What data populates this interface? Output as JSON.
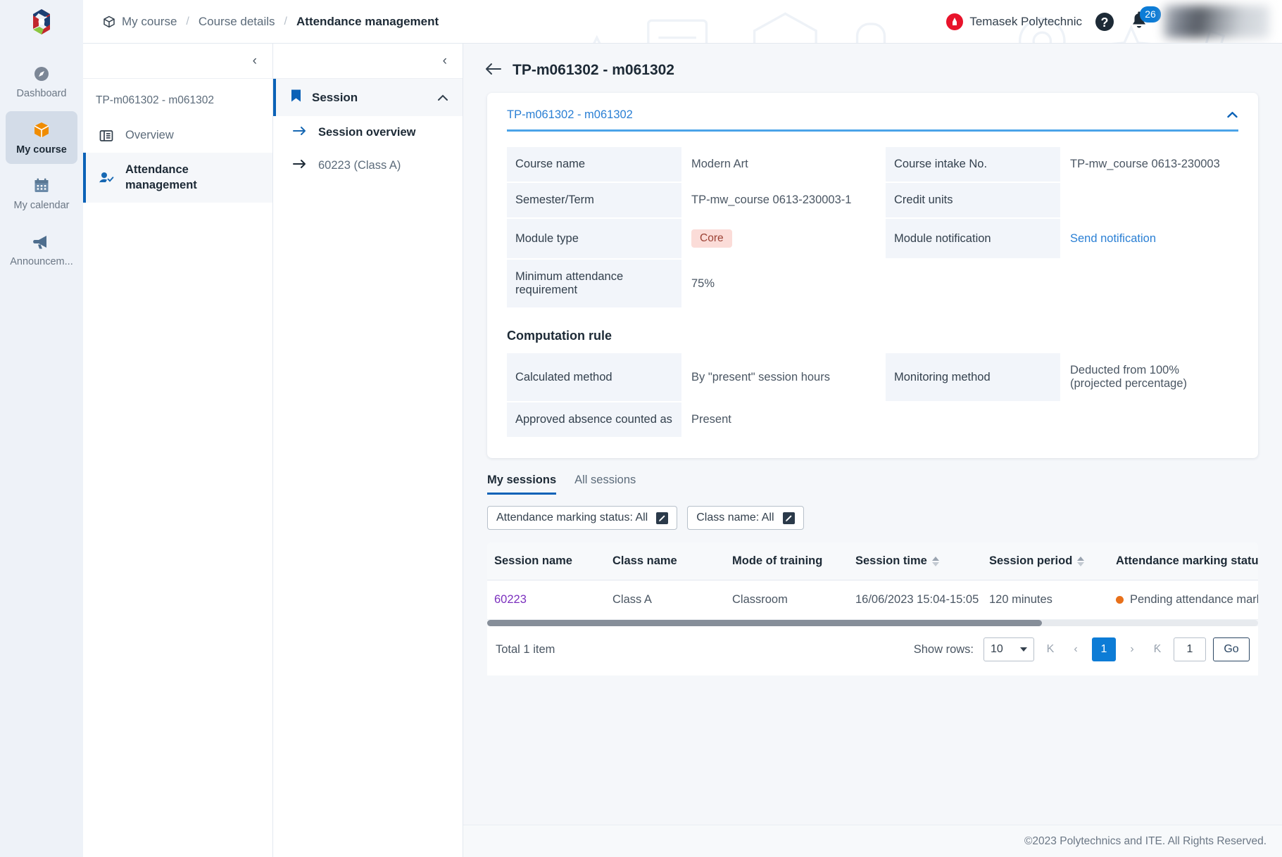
{
  "header": {
    "breadcrumb": [
      {
        "label": "My course",
        "icon": "cube-icon",
        "active": false
      },
      {
        "label": "Course details",
        "active": false
      },
      {
        "label": "Attendance management",
        "active": true
      }
    ],
    "separator": "/",
    "org_name": "Temasek Polytechnic",
    "help_icon": "help-icon",
    "bell_icon": "bell-icon",
    "notification_count": "26"
  },
  "rail": {
    "items": [
      {
        "label": "Dashboard",
        "icon": "compass-icon",
        "selected": false
      },
      {
        "label": "My course",
        "icon": "cube-icon",
        "selected": true
      },
      {
        "label": "My calendar",
        "icon": "calendar-icon",
        "selected": false
      },
      {
        "label": "Announcem...",
        "icon": "megaphone-icon",
        "selected": false
      }
    ]
  },
  "panel1": {
    "collapse_icon": "chevron-left-icon",
    "title": "TP-m061302 - m061302",
    "items": [
      {
        "label": "Overview",
        "icon": "list-icon",
        "selected": false
      },
      {
        "label": "Attendance management",
        "icon": "user-check-icon",
        "selected": true
      }
    ]
  },
  "panel2": {
    "collapse_icon": "chevron-left-icon",
    "group_label": "Session",
    "group_icon": "bookmark-icon",
    "group_chevron": "chevron-up-icon",
    "links": [
      {
        "label": "Session overview",
        "icon": "arrow-right-icon",
        "selected": true
      },
      {
        "label": "60223 (Class A)",
        "icon": "arrow-right-icon",
        "selected": false
      }
    ]
  },
  "main": {
    "back_icon": "arrow-left-icon",
    "page_title": "TP-m061302 - m061302",
    "card": {
      "tab_label": "TP-m061302 - m061302",
      "collapse_icon": "chevron-up-icon",
      "details": [
        {
          "key": "Course name",
          "value": "Modern Art",
          "type": "text"
        },
        {
          "key": "Course intake No.",
          "value": "TP-mw_course 0613-230003",
          "type": "text"
        },
        {
          "key": "Semester/Term",
          "value": "TP-mw_course 0613-230003-1",
          "type": "text"
        },
        {
          "key": "Credit units",
          "value": "",
          "type": "text"
        },
        {
          "key": "Module type",
          "value": "Core",
          "type": "pill"
        },
        {
          "key": "Module notification",
          "value": "Send notification",
          "type": "link"
        },
        {
          "key": "Minimum attendance requirement",
          "value": "75%",
          "type": "text"
        },
        {
          "key": "",
          "value": "",
          "type": "text"
        }
      ],
      "computation_rule_title": "Computation rule",
      "computation": [
        {
          "key": "Calculated method",
          "value": "By \"present\" session hours"
        },
        {
          "key": "Monitoring method",
          "value": "Deducted from 100% (projected percentage)"
        },
        {
          "key": "Approved absence counted as",
          "value": "Present"
        },
        {
          "key": "",
          "value": ""
        }
      ]
    },
    "tabs": [
      {
        "label": "My sessions",
        "selected": true
      },
      {
        "label": "All sessions",
        "selected": false
      }
    ],
    "filters": [
      {
        "label": "Attendance marking status: All",
        "icon": "edit-icon"
      },
      {
        "label": "Class name: All",
        "icon": "edit-icon"
      }
    ],
    "table": {
      "columns": [
        {
          "label": "Session name",
          "sortable": false
        },
        {
          "label": "Class name",
          "sortable": false
        },
        {
          "label": "Mode of training",
          "sortable": false
        },
        {
          "label": "Session time",
          "sortable": true
        },
        {
          "label": "Session period",
          "sortable": true
        },
        {
          "label": "Attendance marking status",
          "sortable": false
        }
      ],
      "rows": [
        {
          "session_name": "60223",
          "class_name": "Class A",
          "mode_of_training": "Classroom",
          "session_time": "16/06/2023 15:04-15:05",
          "session_period": "120 minutes",
          "attendance_marking_status": "Pending attendance marking"
        }
      ],
      "status_color": "#e8701a"
    },
    "pagination": {
      "total": "Total 1 item",
      "show_rows_label": "Show rows:",
      "rows_value": "10",
      "first_icon": "K",
      "prev_icon": "‹",
      "current_page": "1",
      "next_icon": "›",
      "last_icon": "Ƙ",
      "go_value": "1",
      "go_label": "Go"
    }
  },
  "footer": {
    "text": "©2023 Polytechnics and ITE. All Rights Reserved."
  },
  "colors": {
    "accent_blue": "#0b62b7",
    "link_blue": "#2a7fd4",
    "badge_blue": "#0d7cd6",
    "status_orange": "#e8701a",
    "pill_bg": "#fbdcd8",
    "visited_link": "#7b2fbe"
  }
}
